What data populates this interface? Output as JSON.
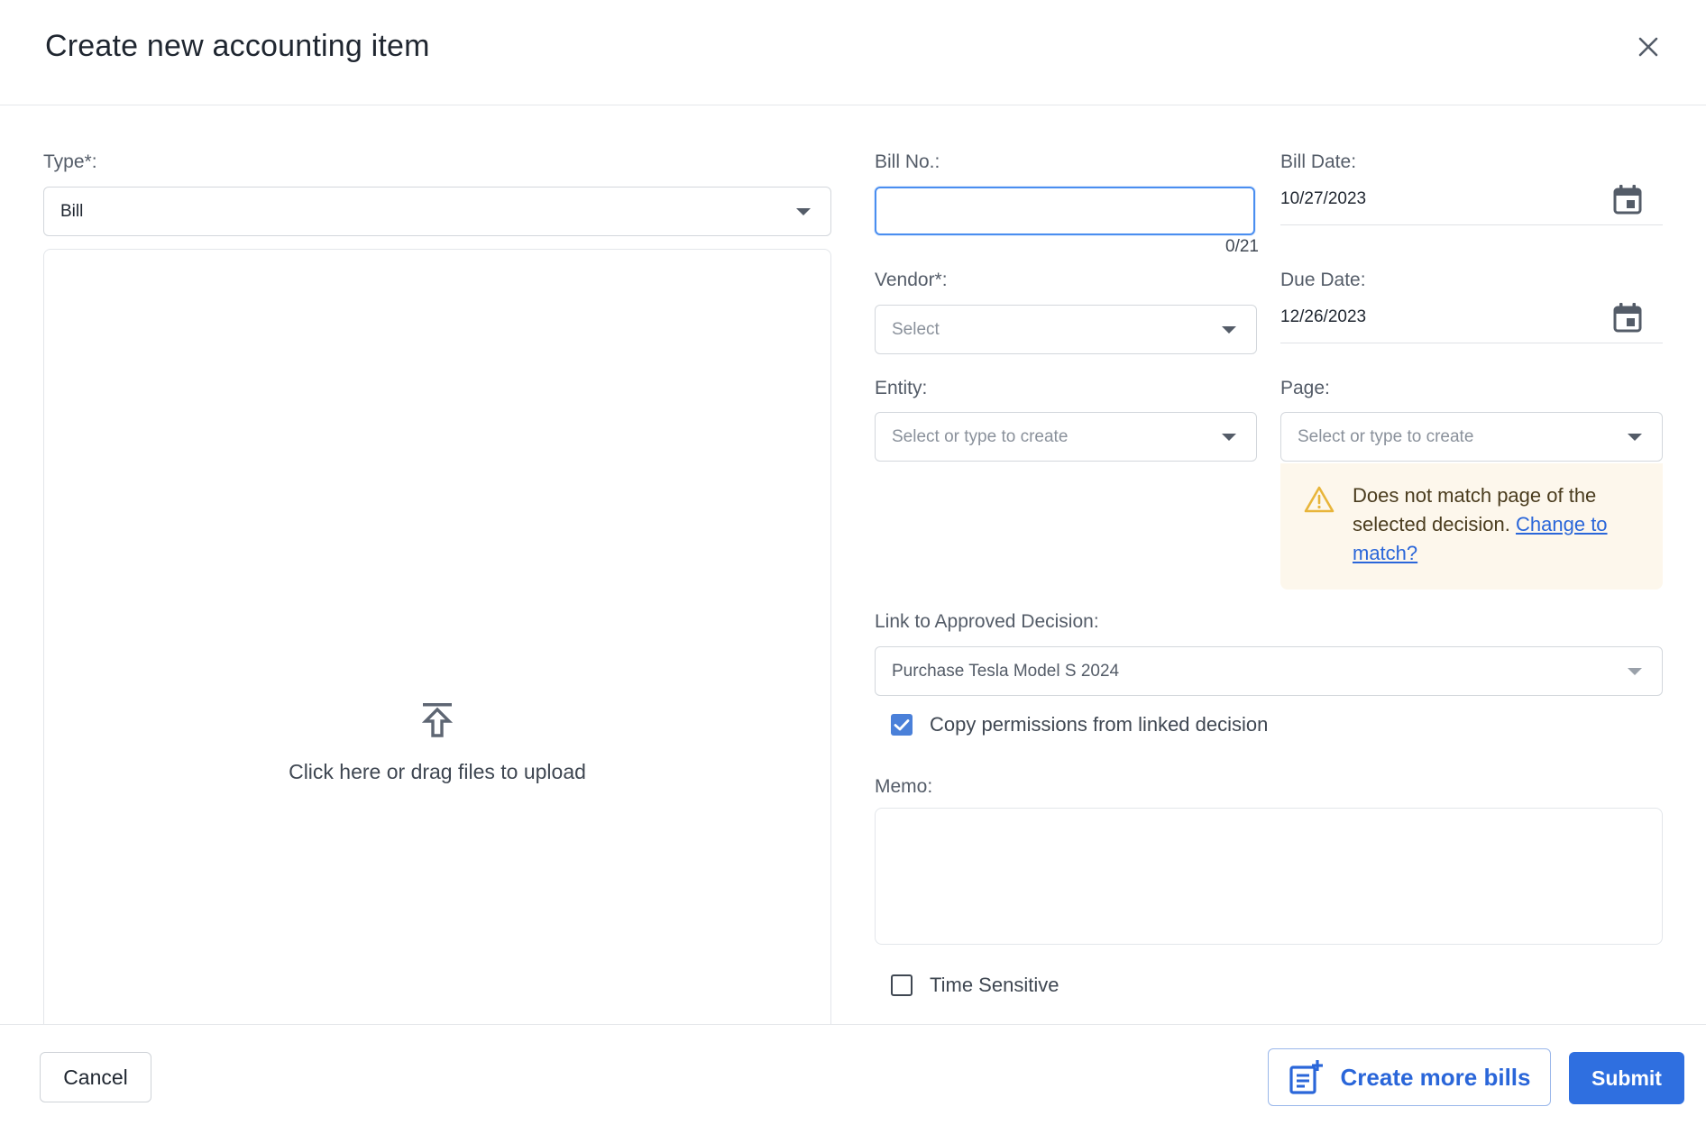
{
  "dialog": {
    "title": "Create new accounting item"
  },
  "type": {
    "label": "Type*:",
    "value": "Bill"
  },
  "upload": {
    "text": "Click here or drag files to upload"
  },
  "bill_no": {
    "label": "Bill No.:",
    "value": "",
    "counter": "0/21"
  },
  "bill_date": {
    "label": "Bill Date:",
    "value": "10/27/2023"
  },
  "vendor": {
    "label": "Vendor*:",
    "placeholder": "Select"
  },
  "due_date": {
    "label": "Due Date:",
    "value": "12/26/2023"
  },
  "entity": {
    "label": "Entity:",
    "placeholder": "Select or type to create"
  },
  "page": {
    "label": "Page:",
    "placeholder": "Select or type to create"
  },
  "warning": {
    "message": "Does not match page of the selected decision.",
    "link": "Change to match?"
  },
  "linked_decision": {
    "label": "Link to Approved Decision:",
    "value": "Purchase Tesla Model S 2024"
  },
  "copy_permissions": {
    "label": "Copy permissions from linked decision",
    "checked": true
  },
  "memo": {
    "label": "Memo:",
    "value": ""
  },
  "time_sensitive": {
    "label": "Time Sensitive",
    "checked": false
  },
  "footer": {
    "cancel_label": "Cancel",
    "create_more_label": "Create more bills",
    "submit_label": "Submit"
  },
  "colors": {
    "primary": "#2f6fe0",
    "focus_border": "#4a8ef0",
    "warning_bg": "#fdf7ec",
    "warning_icon": "#e8b53a",
    "checkbox_checked": "#4a80d9"
  }
}
